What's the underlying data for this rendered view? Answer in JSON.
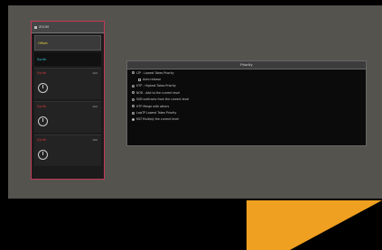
{
  "panel": {
    "header": "ZOOM",
    "rows": [
      {
        "label": "Offset",
        "color": "#e8d23a",
        "amount": ""
      },
      {
        "label": "Synth",
        "color": "#3ac8d8",
        "amount": ""
      }
    ],
    "tracks": [
      {
        "label": "Synth",
        "number": "100"
      },
      {
        "label": "Synth",
        "number": "100"
      },
      {
        "label": "Synth",
        "number": "100"
      }
    ]
  },
  "dialog": {
    "title": "Priority",
    "options": [
      {
        "label": "LTP - Lowest Takes Priority",
        "kind": "radio",
        "on": false,
        "indent": false
      },
      {
        "label": "Auto release",
        "kind": "check",
        "on": false,
        "indent": true
      },
      {
        "label": "HTP - Highest Takes Priority",
        "kind": "radio",
        "on": false,
        "indent": false
      },
      {
        "label": "NOR - Add to the current level",
        "kind": "radio",
        "on": false,
        "indent": false
      },
      {
        "label": "SUB subtracts from the current level",
        "kind": "radio",
        "on": false,
        "indent": false
      },
      {
        "label": "HTP Merge with others",
        "kind": "radio",
        "on": false,
        "indent": false
      },
      {
        "label": "LowTP Lowest Takes Priority",
        "kind": "radio",
        "on": false,
        "indent": false
      },
      {
        "label": "MLT Multiply the current level",
        "kind": "radio",
        "on": true,
        "indent": false
      }
    ]
  },
  "colors": {
    "accent": "#f0a020",
    "panel_border": "#c23a55",
    "window_bg": "#55534e"
  },
  "icons": {
    "knob": "knob-icon",
    "arrow": "orange-arrow"
  }
}
